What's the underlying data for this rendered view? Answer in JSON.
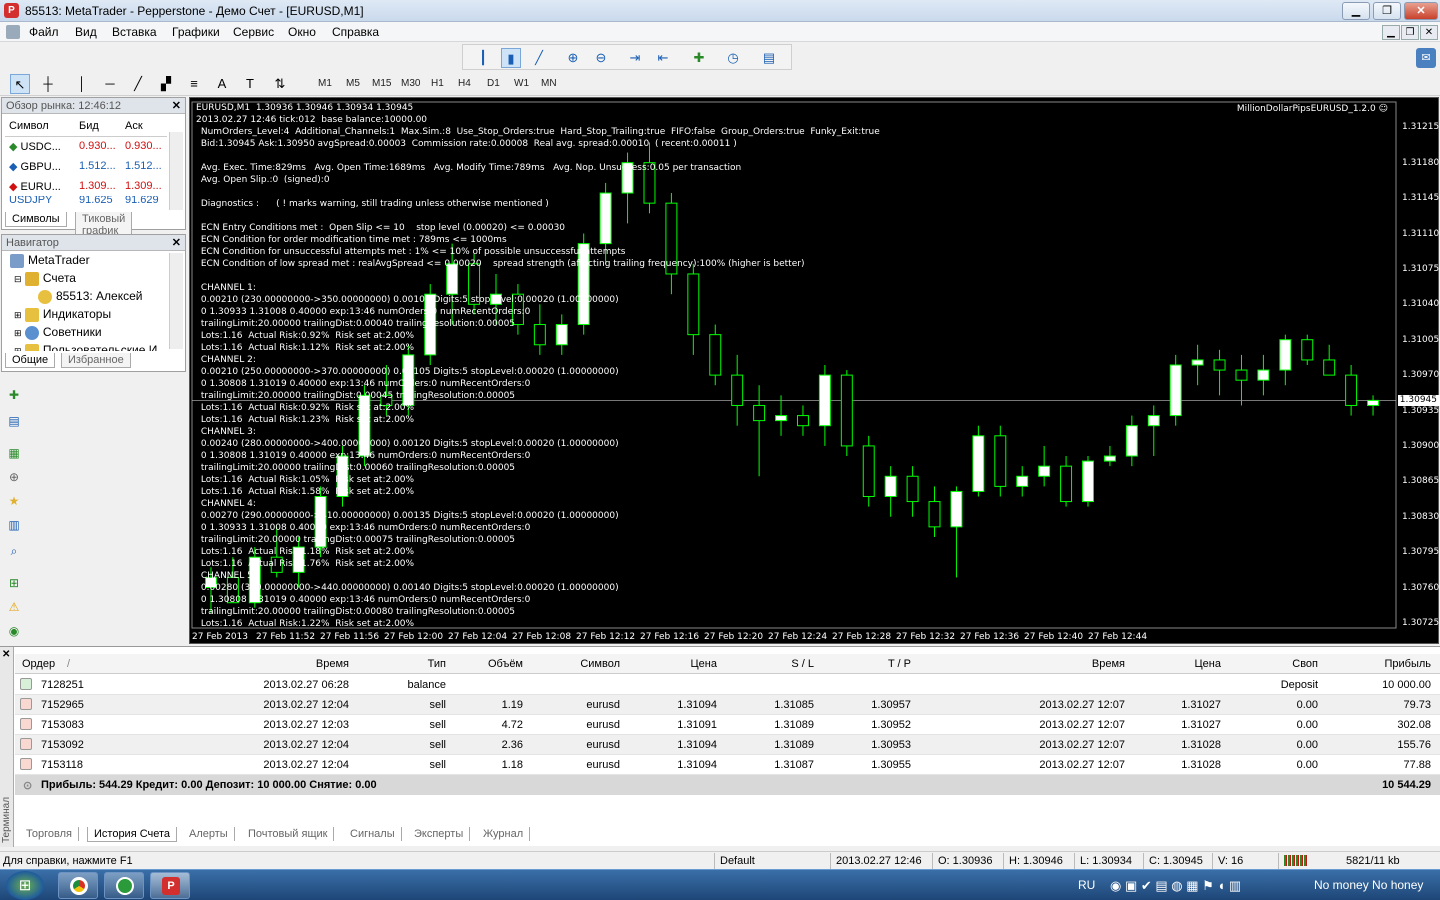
{
  "window": {
    "title": "85513: MetaTrader - Pepperstone - Демо Счет - [EURUSD,M1]"
  },
  "menu": [
    "Файл",
    "Вид",
    "Вставка",
    "Графики",
    "Сервис",
    "Окно",
    "Справка"
  ],
  "timeframes": [
    "M1",
    "M5",
    "M15",
    "M30",
    "H1",
    "H4",
    "D1",
    "W1",
    "MN"
  ],
  "market_watch": {
    "title": "Обзор рынка: 12:46:12",
    "columns": [
      "Символ",
      "Бид",
      "Аск"
    ],
    "rows": [
      {
        "symbol": "USDC...",
        "bid": "0.930...",
        "ask": "0.930..."
      },
      {
        "symbol": "GBPU...",
        "bid": "1.512...",
        "ask": "1.512..."
      },
      {
        "symbol": "EURU...",
        "bid": "1.309...",
        "ask": "1.309..."
      },
      {
        "symbol": "USDJPY",
        "bid": "91.625",
        "ask": "91.629"
      }
    ],
    "tabs": [
      "Символы",
      "Тиковый график"
    ]
  },
  "navigator": {
    "title": "Навигатор",
    "items": [
      "MetaTrader",
      "Счета",
      "85513: Алексей",
      "Индикаторы",
      "Советники",
      "Пользовательские И..."
    ],
    "tabs": [
      "Общие",
      "Избранное"
    ]
  },
  "chart": {
    "header_lines": [
      "EURUSD,M1  1.30936 1.30946 1.30934 1.30945",
      "2013.02.27 12:46 tick:012  base balance:10000.00",
      " NumOrders_Level:4  Additional_Channels:1  Max.Sim.:8  Use_Stop_Orders:true  Hard_Stop_Trailing:true  FIFO:false  Group_Orders:true  Funky_Exit:true",
      " Bid:1.30945 Ask:1.30950 avgSpread:0.00003  Commission rate:0.00008  Real avg. spread:0.00010  ( recent:0.00011 )",
      "",
      " Avg. Exec. Time:829ms   Avg. Open Time:1689ms   Avg. Modify Time:789ms   Avg. Nop. Unsuccess:0.05 per transaction",
      " Avg. Open Slip.:0  (signed):0",
      "",
      " Diagnostics :      ( ! marks warning, still trading unless otherwise mentioned )",
      "",
      " ECN Entry Conditions met :  Open Slip <= 10    stop level (0.00020) <= 0.00030",
      " ECN Condition for order modification time met : 789ms <= 1000ms",
      " ECN Condition for unsuccessful attempts met : 1% <= 10% of possible unsuccessful attempts",
      " ECN Condition of low spread met : realAvgSpread <= 0.00020    spread strength (affecting trailing frequency):100% (higher is better)",
      "",
      " CHANNEL 1:",
      " 0.00210 (230.00000000->350.00000000) 0.00105 Digits:5 stopLevel:0.00020 (1.00000000)",
      " 0 1.30933 1.31008 0.40000 exp:13:46 numOrders:0 numRecentOrders:0",
      " trailingLimit:20.00000 trailingDist:0.00040 trailingResolution:0.00005",
      " Lots:1.16  Actual Risk:0.92%  Risk set at:2.00%",
      " Lots:1.16  Actual Risk:1.12%  Risk set at:2.00%",
      " CHANNEL 2:",
      " 0.00210 (250.00000000->370.00000000) 0.00105 Digits:5 stopLevel:0.00020 (1.00000000)",
      " 0 1.30808 1.31019 0.40000 exp:13:46 numOrders:0 numRecentOrders:0",
      " trailingLimit:20.00000 trailingDist:0.00045 trailingResolution:0.00005",
      " Lots:1.16  Actual Risk:0.92%  Risk set at:2.00%",
      " Lots:1.16  Actual Risk:1.23%  Risk set at:2.00%",
      " CHANNEL 3:",
      " 0.00240 (280.00000000->400.00000000) 0.00120 Digits:5 stopLevel:0.00020 (1.00000000)",
      " 0 1.30808 1.31019 0.40000 exp:13:46 numOrders:0 numRecentOrders:0",
      " trailingLimit:20.00000 trailingDist:0.00060 trailingResolution:0.00005",
      " Lots:1.16  Actual Risk:1.05%  Risk set at:2.00%",
      " Lots:1.16  Actual Risk:1.58%  Risk set at:2.00%",
      " CHANNEL 4:",
      " 0.00270 (290.00000000->410.00000000) 0.00135 Digits:5 stopLevel:0.00020 (1.00000000)",
      " 0 1.30933 1.31008 0.40000 exp:13:46 numOrders:0 numRecentOrders:0",
      " trailingLimit:20.00000 trailingDist:0.00075 trailingResolution:0.00005",
      " Lots:1.16  Actual Risk:1.18%  Risk set at:2.00%",
      " Lots:1.16  Actual Risk:1.76%  Risk set at:2.00%",
      " CHANNEL 5:",
      " 0.00280 (320.00000000->440.00000000) 0.00140 Digits:5 stopLevel:0.00020 (1.00000000)",
      " 0 1.30808 1.31019 0.40000 exp:13:46 numOrders:0 numRecentOrders:0",
      " trailingLimit:20.00000 trailingDist:0.00080 trailingResolution:0.00005",
      " Lots:1.16  Actual Risk:1.22%  Risk set at:2.00%"
    ],
    "ea_name": "MillionDollarPipsEURUSD_1.2.0",
    "price_labels": [
      "1.31215",
      "1.31180",
      "1.31145",
      "1.31110",
      "1.31075",
      "1.31040",
      "1.31005",
      "1.30970",
      "1.30935",
      "1.30900",
      "1.30865",
      "1.30830",
      "1.30795",
      "1.30760",
      "1.30725"
    ],
    "current_price": "1.30945",
    "time_labels": [
      "27 Feb 2013",
      "27 Feb 11:52",
      "27 Feb 11:56",
      "27 Feb 12:00",
      "27 Feb 12:04",
      "27 Feb 12:08",
      "27 Feb 12:12",
      "27 Feb 12:16",
      "27 Feb 12:20",
      "27 Feb 12:24",
      "27 Feb 12:28",
      "27 Feb 12:32",
      "27 Feb 12:36",
      "27 Feb 12:40",
      "27 Feb 12:44"
    ]
  },
  "chart_data": {
    "type": "candlestick",
    "symbol": "EURUSD",
    "timeframe": "M1",
    "ylim": [
      1.3072,
      1.3124
    ],
    "candles": [
      [
        1.3076,
        1.3078,
        1.30735,
        1.3077
      ],
      [
        1.3077,
        1.3079,
        1.3075,
        1.30745
      ],
      [
        1.30745,
        1.308,
        1.3074,
        1.3079
      ],
      [
        1.3079,
        1.3082,
        1.3077,
        1.30775
      ],
      [
        1.30775,
        1.3081,
        1.3076,
        1.308
      ],
      [
        1.308,
        1.3086,
        1.3079,
        1.3085
      ],
      [
        1.3085,
        1.309,
        1.3084,
        1.3089
      ],
      [
        1.3089,
        1.3096,
        1.3088,
        1.3095
      ],
      [
        1.3095,
        1.3098,
        1.3093,
        1.3094
      ],
      [
        1.3094,
        1.31,
        1.3093,
        1.3099
      ],
      [
        1.3099,
        1.3106,
        1.3098,
        1.3105
      ],
      [
        1.3105,
        1.311,
        1.3102,
        1.3108
      ],
      [
        1.3108,
        1.3109,
        1.3103,
        1.3104
      ],
      [
        1.3104,
        1.3107,
        1.3102,
        1.3105
      ],
      [
        1.3105,
        1.3106,
        1.3101,
        1.3102
      ],
      [
        1.3102,
        1.3104,
        1.3099,
        1.31
      ],
      [
        1.31,
        1.3103,
        1.3099,
        1.3102
      ],
      [
        1.3102,
        1.3111,
        1.3101,
        1.311
      ],
      [
        1.311,
        1.3116,
        1.3108,
        1.3115
      ],
      [
        1.3115,
        1.3119,
        1.3112,
        1.3118
      ],
      [
        1.3118,
        1.312,
        1.3113,
        1.3114
      ],
      [
        1.3114,
        1.3115,
        1.3105,
        1.3107
      ],
      [
        1.3107,
        1.3108,
        1.3099,
        1.3101
      ],
      [
        1.3101,
        1.3102,
        1.3096,
        1.3097
      ],
      [
        1.3097,
        1.3099,
        1.3092,
        1.3094
      ],
      [
        1.3094,
        1.3096,
        1.3087,
        1.30925
      ],
      [
        1.30925,
        1.3095,
        1.3091,
        1.3093
      ],
      [
        1.3093,
        1.3094,
        1.3091,
        1.3092
      ],
      [
        1.3092,
        1.3098,
        1.309,
        1.3097
      ],
      [
        1.3097,
        1.30975,
        1.3089,
        1.309
      ],
      [
        1.309,
        1.3091,
        1.3084,
        1.3085
      ],
      [
        1.3085,
        1.3088,
        1.3083,
        1.3087
      ],
      [
        1.3087,
        1.3088,
        1.3083,
        1.30845
      ],
      [
        1.30845,
        1.3086,
        1.3081,
        1.3082
      ],
      [
        1.3082,
        1.3086,
        1.3077,
        1.30855
      ],
      [
        1.30855,
        1.3092,
        1.3085,
        1.3091
      ],
      [
        1.3091,
        1.3092,
        1.3085,
        1.3086
      ],
      [
        1.3086,
        1.3088,
        1.3085,
        1.3087
      ],
      [
        1.3087,
        1.309,
        1.3086,
        1.3088
      ],
      [
        1.3088,
        1.3089,
        1.3084,
        1.30845
      ],
      [
        1.30845,
        1.3089,
        1.3084,
        1.30885
      ],
      [
        1.30885,
        1.309,
        1.3088,
        1.3089
      ],
      [
        1.3089,
        1.3093,
        1.3088,
        1.3092
      ],
      [
        1.3092,
        1.3094,
        1.3089,
        1.3093
      ],
      [
        1.3093,
        1.3099,
        1.3092,
        1.3098
      ],
      [
        1.3098,
        1.31,
        1.3096,
        1.30985
      ],
      [
        1.30985,
        1.30995,
        1.3095,
        1.30975
      ],
      [
        1.30975,
        1.3099,
        1.3094,
        1.30965
      ],
      [
        1.30965,
        1.3099,
        1.3095,
        1.30975
      ],
      [
        1.30975,
        1.3101,
        1.3096,
        1.31005
      ],
      [
        1.31005,
        1.3101,
        1.3098,
        1.30985
      ],
      [
        1.30985,
        1.31,
        1.3097,
        1.3097
      ],
      [
        1.3097,
        1.3098,
        1.3093,
        1.3094
      ],
      [
        1.3094,
        1.3095,
        1.3093,
        1.30945
      ]
    ]
  },
  "terminal": {
    "side_label": "Терминал",
    "columns": [
      "Ордер",
      "/",
      "Время",
      "Тип",
      "Объём",
      "Символ",
      "Цена",
      "S / L",
      "T / P",
      "Время",
      "Цена",
      "Своп",
      "Прибыль"
    ],
    "rows": [
      {
        "order": "7128251",
        "time": "2013.02.27 06:28",
        "type": "balance",
        "volume": "",
        "symbol": "",
        "price": "",
        "sl": "",
        "tp": "",
        "close_time": "",
        "close_price": "",
        "swap": "Deposit",
        "profit": "10 000.00"
      },
      {
        "order": "7152965",
        "time": "2013.02.27 12:04",
        "type": "sell",
        "volume": "1.19",
        "symbol": "eurusd",
        "price": "1.31094",
        "sl": "1.31085",
        "tp": "1.30957",
        "close_time": "2013.02.27 12:07",
        "close_price": "1.31027",
        "swap": "0.00",
        "profit": "79.73"
      },
      {
        "order": "7153083",
        "time": "2013.02.27 12:03",
        "type": "sell",
        "volume": "4.72",
        "symbol": "eurusd",
        "price": "1.31091",
        "sl": "1.31089",
        "tp": "1.30952",
        "close_time": "2013.02.27 12:07",
        "close_price": "1.31027",
        "swap": "0.00",
        "profit": "302.08"
      },
      {
        "order": "7153092",
        "time": "2013.02.27 12:04",
        "type": "sell",
        "volume": "2.36",
        "symbol": "eurusd",
        "price": "1.31094",
        "sl": "1.31089",
        "tp": "1.30953",
        "close_time": "2013.02.27 12:07",
        "close_price": "1.31028",
        "swap": "0.00",
        "profit": "155.76"
      },
      {
        "order": "7153118",
        "time": "2013.02.27 12:04",
        "type": "sell",
        "volume": "1.18",
        "symbol": "eurusd",
        "price": "1.31094",
        "sl": "1.31087",
        "tp": "1.30955",
        "close_time": "2013.02.27 12:07",
        "close_price": "1.31028",
        "swap": "0.00",
        "profit": "77.88"
      }
    ],
    "summary_text": "Прибыль: 544.29  Кредит: 0.00  Депозит: 10 000.00  Снятие: 0.00",
    "summary_total": "10 544.29",
    "tabs": [
      "Торговля",
      "История Счета",
      "Алерты",
      "Почтовый ящик",
      "Сигналы",
      "Эксперты",
      "Журнал"
    ]
  },
  "status": {
    "help": "Для справки, нажмите F1",
    "profile": "Default",
    "datetime": "2013.02.27 12:46",
    "open": "O: 1.30936",
    "high": "H: 1.30946",
    "low": "L: 1.30934",
    "close": "C: 1.30945",
    "volume": "V: 16",
    "traffic": "5821/11 kb"
  },
  "taskbar": {
    "lang": "RU",
    "tray_text": "No money No honey"
  },
  "colors": {
    "chart_bg": "#000000",
    "bull": "#ffffff",
    "bear": "#000000",
    "wick": "#00ff00",
    "grid_line": "#c0c0c0"
  }
}
